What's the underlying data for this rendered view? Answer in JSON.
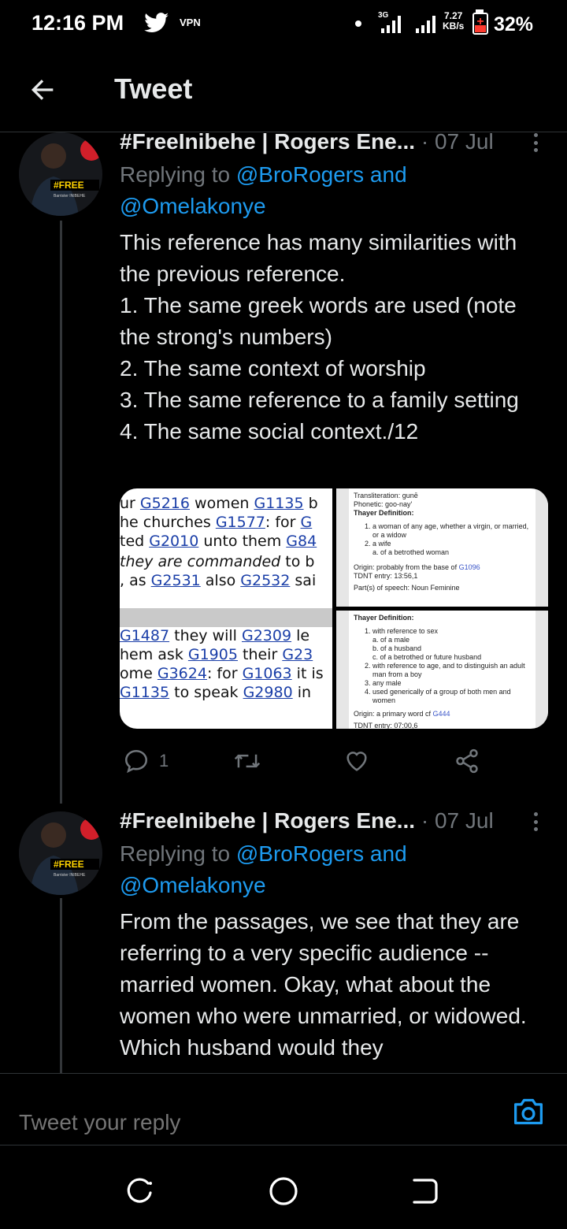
{
  "status_bar": {
    "time": "12:16 PM",
    "vpn": "VPN",
    "network": "3G",
    "speed_value": "7.27",
    "speed_unit": "KB/s",
    "battery": "32%",
    "icons": [
      "twitter-bird-icon",
      "signal-icon",
      "battery-charging-icon"
    ]
  },
  "header": {
    "title": "Tweet",
    "back_icon": "arrow-left-icon"
  },
  "tweets": [
    {
      "author": "#FreeInibehe | Rogers Ene...",
      "separator": "·",
      "date": "07 Jul",
      "replying_prefix": "Replying to",
      "replying_mention1": "@BroRogers",
      "replying_and": "and",
      "replying_mention2": "@Omelakonye",
      "text": "This reference has many similarities with the previous reference.\n1. The same greek words are used (note the strong's numbers)\n2. The same context of worship\n3. The same reference to a family setting\n4. The same social context./12",
      "replies": "1",
      "avatar_badge": "#FREE",
      "avatar_caption": "Barrister INIBEHE"
    },
    {
      "author": "#FreeInibehe | Rogers Ene...",
      "separator": "·",
      "date": "07 Jul",
      "replying_prefix": "Replying to",
      "replying_mention1": "@BroRogers",
      "replying_and": "and",
      "replying_mention2": "@Omelakonye",
      "text": "From the passages, we see that they are referring to a very specific audience --married women. Okay, what about the women who were unmarried, or widowed. Which husband would they",
      "avatar_badge": "#FREE",
      "avatar_caption": "Barrister INIBEHE"
    }
  ],
  "media": {
    "left_rows": [
      [
        {
          "t": "ur "
        },
        {
          "t": "G5216",
          "l": true
        },
        {
          "t": " women "
        },
        {
          "t": "G1135",
          "l": true
        },
        {
          "t": " b"
        }
      ],
      [
        {
          "t": "he churches "
        },
        {
          "t": "G1577",
          "l": true
        },
        {
          "t": ": for "
        },
        {
          "t": "G",
          "l": true
        }
      ],
      [
        {
          "t": "ted "
        },
        {
          "t": "G2010",
          "l": true
        },
        {
          "t": " unto them "
        },
        {
          "t": "G84",
          "l": true
        }
      ],
      [
        {
          "t": "they are commanded",
          "i": true
        },
        {
          "t": " to b"
        }
      ],
      [
        {
          "t": ", as "
        },
        {
          "t": "G2531",
          "l": true
        },
        {
          "t": " also "
        },
        {
          "t": "G2532",
          "l": true
        },
        {
          "t": " sai"
        }
      ],
      [
        {
          "t": " "
        },
        {
          "t": "G1487",
          "l": true
        },
        {
          "t": " they will "
        },
        {
          "t": "G2309",
          "l": true
        },
        {
          "t": " le"
        }
      ],
      [
        {
          "t": "hem ask "
        },
        {
          "t": "G1905",
          "l": true
        },
        {
          "t": " their "
        },
        {
          "t": "G23",
          "l": true
        }
      ],
      [
        {
          "t": "ome "
        },
        {
          "t": "G3624",
          "l": true
        },
        {
          "t": ": for "
        },
        {
          "t": "G1063",
          "l": true
        },
        {
          "t": " it is"
        }
      ],
      [
        {
          "t": "G1135",
          "l": true
        },
        {
          "t": " to speak "
        },
        {
          "t": "G2980",
          "l": true
        },
        {
          "t": " in "
        }
      ]
    ],
    "right_top": {
      "transliteration": "Transliteration: gunē",
      "phonetic": "Phonetic: goo-nay'",
      "heading": "Thayer Definition:",
      "items": [
        "1. a woman of any age, whether a virgin, or married,",
        "or a widow",
        "2. a wife",
        "a. of a betrothed woman"
      ],
      "origin_label": "Origin: probably from the base of",
      "origin_ref": "G1096",
      "tdnt": "TDNT entry: 13:56,1",
      "pos": "Part(s) of speech: Noun Feminine"
    },
    "right_bottom": {
      "heading": "Thayer Definition:",
      "items": [
        "1. with reference to sex",
        "a. of a male",
        "b. of a husband",
        "c. of a betrothed or future husband",
        "2. with reference to age, and to distinguish an adult",
        "man from a boy",
        "3. any male",
        "4. used generically of a group of both men and",
        "women"
      ],
      "origin_label": "Origin: a primary word cf",
      "origin_ref": "G444",
      "tdnt": "TDNT entry: 07:00,6"
    }
  },
  "reply_bar": {
    "placeholder": "Tweet your reply",
    "camera_icon": "camera-icon"
  },
  "nav": [
    "recents-icon",
    "home-icon",
    "back-icon"
  ],
  "colors": {
    "background": "#000000",
    "text": "#e7e9ea",
    "muted": "#71767b",
    "accent": "#1d9bf0",
    "divider": "#2f3336"
  }
}
